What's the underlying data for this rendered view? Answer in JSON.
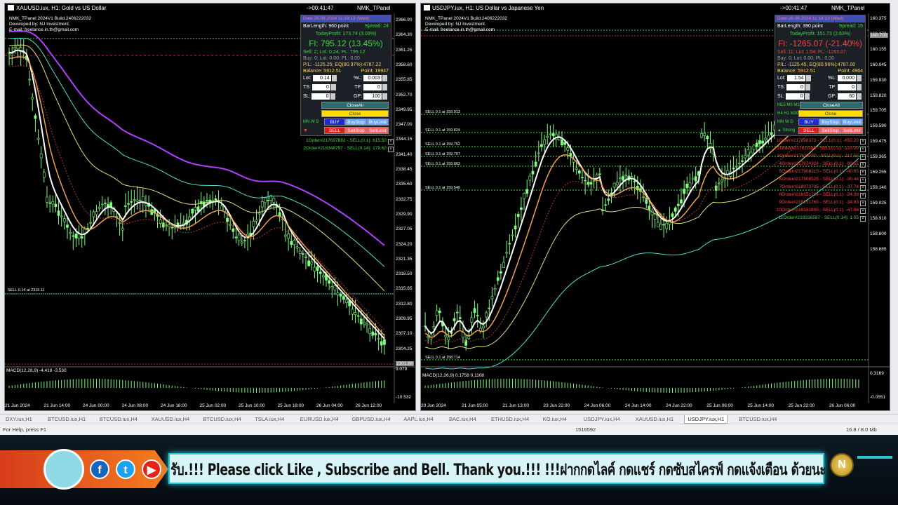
{
  "left_chart": {
    "title": "XAUUSD.iux, H1:  Gold vs US Dollar",
    "timer": "->00:41:47",
    "panel_name": "NMK_TPanel",
    "info_lines": [
      "NMK_TPanel 2024V1 Build.2406222032",
      "Developed by: NJ Investment.",
      "E-mail: freelance.in.th@gmail.com"
    ],
    "panel": {
      "header": "Date:26.06.2024 11:18:13 (Wed)",
      "bar_length": "BarLength: 960 point",
      "spread": "Spread: 24",
      "today_profit": "TodayProfit: 173.74 (3.03%)",
      "fl": "Fl: 795.12 (13.45%)",
      "sell_line": "Sell: 2; Lot: 0.24; PL: 795.12",
      "buy_line": "Buy: 0; Lot: 0.00; PL: 0.00",
      "pl_line": "P/L: -1125.25; EQ(80.97%):4787.22",
      "balance": "Balance: 5912.51",
      "point": "Point: 19947",
      "lot_label": "Lot:",
      "lot_value": "0.14",
      "pctl_label": "%L:",
      "pctl_value": "0.003",
      "ts_label": "TS:",
      "ts_value": "0",
      "tp_label": "TP:",
      "tp_value": "0",
      "sl_label": "SL:",
      "sl_value": "0",
      "gp_label": "GP:",
      "gp_value": "100",
      "close_all": "CloseAll",
      "close": "Close",
      "buy": "BUY",
      "buy_stop": "BuyStop",
      "buy_limit": "BuyLimit",
      "sell": "SELL",
      "sell_stop": "SellStop",
      "sell_limit": "SellLimit",
      "side_labels": [
        "MN",
        "W",
        "D"
      ]
    },
    "orders": [
      "1Order#217697882 - SELL(0.1): 615.50",
      "2Order#218348757 - SELL(0.14): 179.62"
    ],
    "sell_line_label": "SELL 0.14 at 2315.11",
    "price_ticks": [
      "2366.90",
      "2364.30",
      "2361.25",
      "2358.60",
      "2355.85",
      "2352.70",
      "2349.95",
      "2347.00",
      "2344.15",
      "2341.40",
      "2338.45",
      "2335.60",
      "2332.75",
      "2329.90",
      "2327.05",
      "2324.20",
      "2321.35",
      "2318.50",
      "2315.65",
      "2312.80",
      "2309.95",
      "2307.10",
      "2304.25"
    ],
    "current_price": "2301.88",
    "macd_label": "MACD(12,26,9) -4.418 -3.530",
    "macd_ticks": [
      "9.079",
      "-10.532"
    ],
    "time_ticks": [
      "21 Jun 2024",
      "21 Jun 14:00",
      "24 Jun 00:00",
      "24 Jun 08:00",
      "24 Jun 16:00",
      "25 Jun 02:00",
      "25 Jun 10:00",
      "25 Jun 18:00",
      "26 Jun 04:00",
      "26 Jun 12:00"
    ]
  },
  "right_chart": {
    "title": "USDJPY.iux, H1:  US Dollar vs Japanese Yen",
    "timer": "->00:41:47",
    "panel_name": "NMK_TPanel",
    "info_lines": [
      "NMK_TPanel 2024V1 Build.2406222032",
      "Developed by: NJ Investment.",
      "E-mail: freelance.in.th@gmail.com"
    ],
    "panel": {
      "header": "Date:26.06.2024 11:18:13 (Wed)",
      "bar_length": "BarLength: 390 point",
      "spread": "Spread: 15",
      "today_profit": "TodayProfit: 151.73 (2.63%)",
      "fl": "Fl: -1265.07 (-21.40%)",
      "sell_line": "Sell: 11; Lot: 1.54; PL: -1265.07",
      "buy_line": "Buy: 0; Lot: 0.00; PL: 0.00",
      "pl_line": "P/L: -1125.45; EQ(80.96%):4787.00",
      "balance": "Balance: 5912.51",
      "point": "Point: 4964",
      "lot_label": "Lot:",
      "lot_value": "1.54",
      "pctl_label": "%L:",
      "pctl_value": "0.000",
      "ts_label": "TS:",
      "ts_value": "0",
      "tp_label": "TP:",
      "tp_value": "0",
      "sl_label": "SL:",
      "sl_value": "0",
      "gp_label": "GP:",
      "gp_value": "60",
      "close_all": "CloseAll",
      "close": "Close",
      "buy": "BUY",
      "buy_stop": "BuyStop",
      "buy_limit": "BuyLimit",
      "sell": "SELL",
      "sell_stop": "SellStop",
      "sell_limit": "SellLimit",
      "side_labels": [
        "M15",
        "M5",
        "M1",
        "H4",
        "H1",
        "M30",
        "MN",
        "W",
        "D"
      ],
      "strong": "Strong"
    },
    "orders": [
      {
        "text": "1Order#217398373 - SELL(0.1): -650.20",
        "color": "#ff4040"
      },
      {
        "text": "2Order#217611188 - SELL(0.1): -120.20",
        "color": "#ff4040"
      },
      {
        "text": "3Order#217623750 - SELL(0.1): -117.55",
        "color": "#ff4040"
      },
      {
        "text": "4Order#217674324 - SELL(0.1): -90.55",
        "color": "#ff4040"
      },
      {
        "text": "5Order#217908215 - SELL(0.1): -40.65",
        "color": "#ff4040"
      },
      {
        "text": "6Order#217908525 - SELL(0.1): -30.44",
        "color": "#ff4040"
      },
      {
        "text": "7Order#218073735 - SELL(0.1): -37.74",
        "color": "#ff4040"
      },
      {
        "text": "8Order#218151714 - SELL(0.1): -24.39",
        "color": "#ff4040"
      },
      {
        "text": "9Order#218151769 - SELL(0.1): -34.93",
        "color": "#ff4040"
      },
      {
        "text": "10Order#218151805 - SELL(0.1): -47.56",
        "color": "#ff4040"
      },
      {
        "text": "11Order#218336587 - SELL(0.14): 1.05",
        "color": "#3cdb3c"
      }
    ],
    "sell_labels": [
      "SELL 0.1 at 159.913",
      "SELL 0.1 at 159.824",
      "SELL 0.1 at 159.752",
      "SELL 0.1 at 159.707",
      "SELL 0.1 at 159.663",
      "SELL 0.1 at 159.546",
      "SELL 0.1 at 158.714"
    ],
    "price_ticks": [
      "160.375",
      "160.270",
      "160.155",
      "160.045",
      "159.930",
      "159.820",
      "159.705",
      "159.590",
      "159.475",
      "159.365",
      "159.255",
      "159.140",
      "159.025",
      "158.910",
      "158.800",
      "158.685"
    ],
    "current_price": "160.700",
    "macd_label": "MACD(12,26,9) 0.1758 0.1108",
    "macd_ticks": [
      "0.3169",
      "-0.0551"
    ],
    "time_ticks": [
      "20 Jun 2024",
      "21 Jun 05:00",
      "21 Jun 13:00",
      "23 Jun 22:00",
      "24 Jun 06:00",
      "24 Jun 14:00",
      "24 Jun 22:00",
      "25 Jun 06:00",
      "25 Jun 14:00",
      "25 Jun 22:00",
      "26 Jun 06:00"
    ]
  },
  "tabs": [
    "DXY.iux,H1",
    "BTCUSD.iux,H1",
    "BTCUSD.iux,H4",
    "XAUUSD.iux,H4",
    "BTCUSD.iux,H4",
    "TSLA.iux,H4",
    "EURUSD.iux,H4",
    "GBPUSD.iux,H4",
    "AAPL.iux,H4",
    "BAC.iux,H4",
    "ETHUSD.iux,H4",
    "KO.iux,H4",
    "USDJPY.iux,H4",
    "XAUUSD.iux,H1",
    "USDJPY.iux,H1",
    "BTCUSD.iux,H4"
  ],
  "active_tab_index": 14,
  "status": {
    "help": "For Help, press F1",
    "id": "1516592",
    "traffic": "16.8 / 8.0 Mb"
  },
  "banner": {
    "text": "รับ.!!! Please click Like , Subscribe and Bell. Thank you.!!! !!!ฝากกดไลค์ กดแชร์ กดซับสไครฟ์ กดแจ้งเตือน ด้วยนะ",
    "social_icons": [
      "facebook-icon",
      "twitter-icon",
      "youtube-icon"
    ],
    "badge_letter": "N",
    "accent_color": "#2fc6d4"
  }
}
